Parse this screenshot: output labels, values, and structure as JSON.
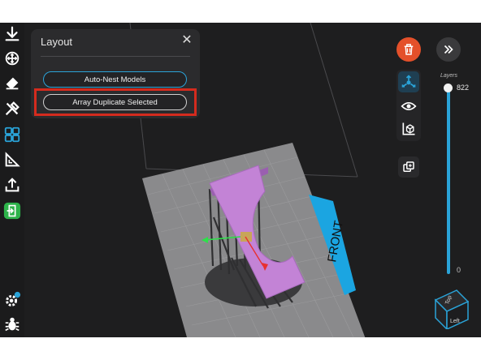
{
  "toolbar": {
    "items": [
      {
        "name": "download-icon"
      },
      {
        "name": "move-icon"
      },
      {
        "name": "orient-icon"
      },
      {
        "name": "tools-icon"
      },
      {
        "name": "layout-icon",
        "active": true
      },
      {
        "name": "measure-icon"
      },
      {
        "name": "export-icon"
      },
      {
        "name": "exit-icon"
      },
      {
        "name": "settings-icon"
      },
      {
        "name": "bug-icon"
      }
    ]
  },
  "layout_panel": {
    "title": "Layout",
    "close_glyph": "✕",
    "auto_nest_label": "Auto-Nest Models",
    "array_duplicate_label": "Array Duplicate Selected"
  },
  "scene": {
    "front_label": "FRONT",
    "plate_color": "#8a8a8c",
    "model_color": "#c383d6",
    "front_color": "#1ba5e1"
  },
  "right_panel": {
    "delete_icon": "trash-icon",
    "expand_icon": "double-chevron-right-icon",
    "tools": [
      "transform-gizmo-icon",
      "visibility-icon",
      "bounding-box-icon"
    ],
    "duplicate_icon": "duplicate-icon"
  },
  "layers": {
    "label": "Layers",
    "top_value": "822",
    "bottom_value": "0",
    "fill": 1.0
  },
  "viewcube": {
    "top_label": "Top",
    "left_label": "Left"
  },
  "colors": {
    "accent": "#2aa3d8",
    "delete": "#e4502a",
    "highlight": "#d42b1e",
    "exit_green": "#2db34a"
  }
}
